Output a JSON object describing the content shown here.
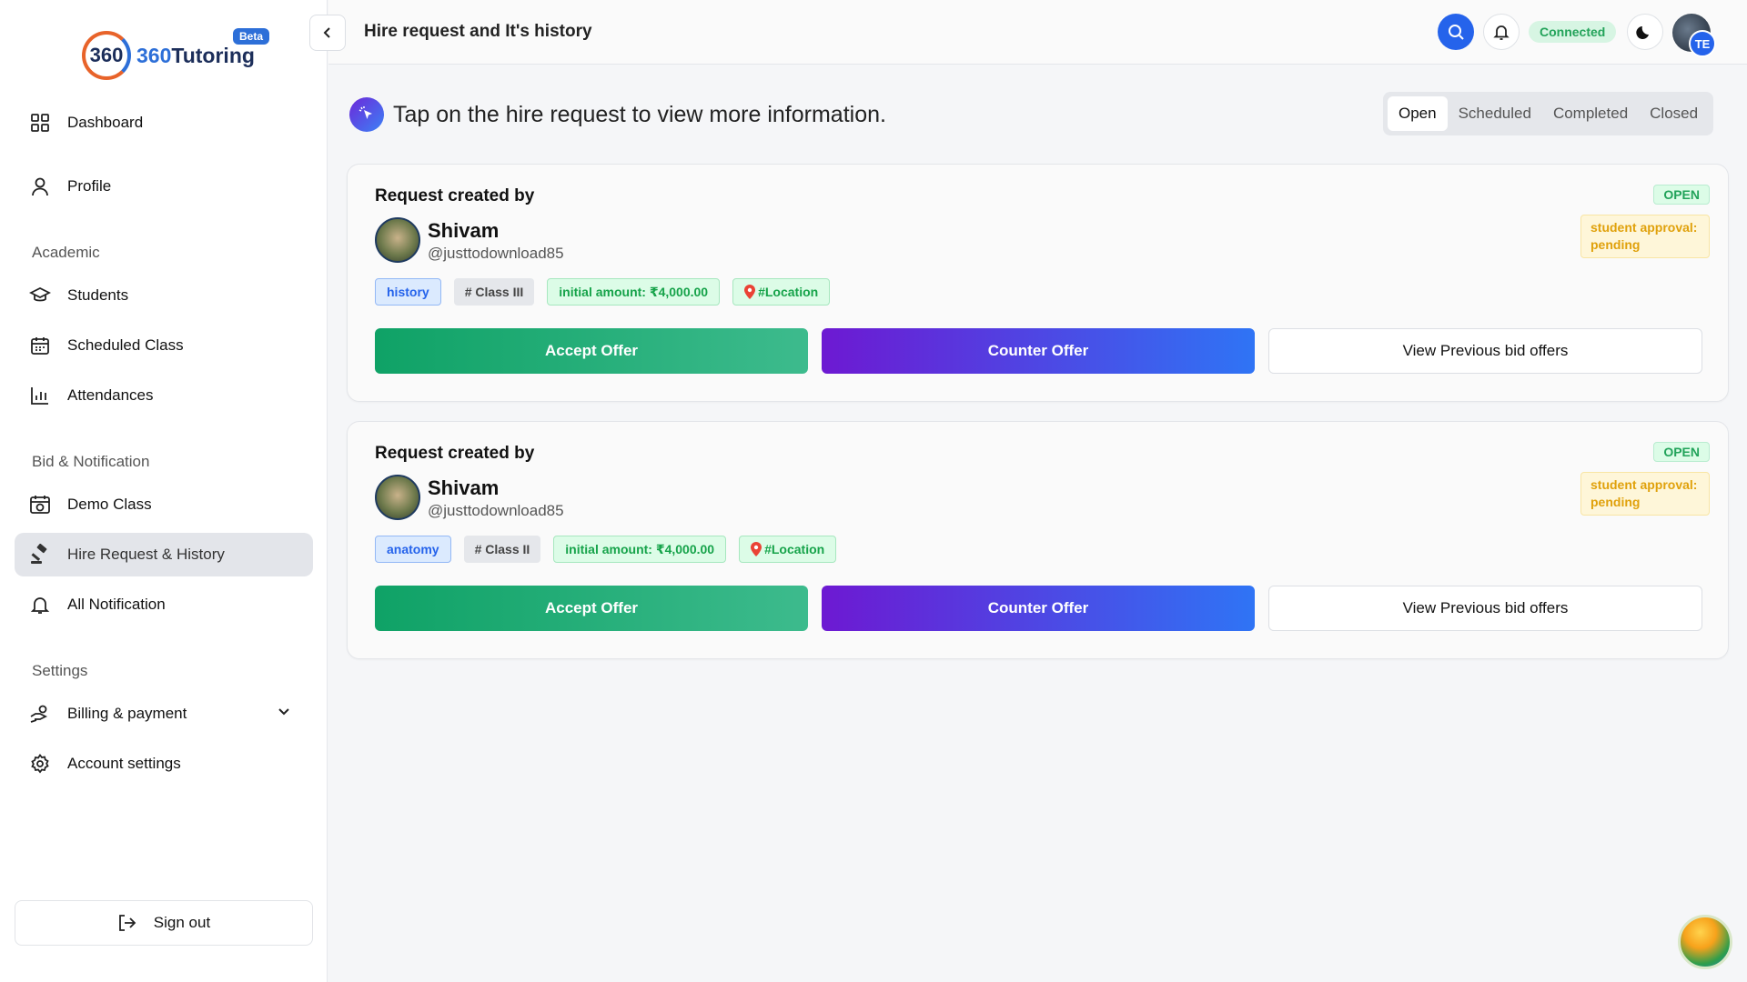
{
  "brand": {
    "logo_mark": "360",
    "name_num": "360",
    "name_text": "Tutoring",
    "badge": "Beta"
  },
  "sidebar": {
    "items_top": [
      {
        "label": "Dashboard",
        "icon": "grid-icon"
      },
      {
        "label": "Profile",
        "icon": "user-icon"
      }
    ],
    "sections": {
      "academic": "Academic",
      "bid": "Bid & Notification",
      "settings": "Settings"
    },
    "academic_items": [
      {
        "label": "Students",
        "icon": "graduation-cap-icon"
      },
      {
        "label": "Scheduled Class",
        "icon": "calendar-icon"
      },
      {
        "label": "Attendances",
        "icon": "bar-chart-icon"
      }
    ],
    "bid_items": [
      {
        "label": "Demo Class",
        "icon": "calendar-play-icon"
      },
      {
        "label": "Hire Request & History",
        "icon": "gavel-icon",
        "active": true
      },
      {
        "label": "All Notification",
        "icon": "bell-icon"
      }
    ],
    "settings_items": [
      {
        "label": "Billing & payment",
        "icon": "hand-coins-icon"
      },
      {
        "label": "Account settings",
        "icon": "gear-icon"
      }
    ],
    "signout": "Sign out"
  },
  "header": {
    "title": "Hire request and It's history",
    "connection_status": "Connected",
    "avatar_initials": "TE"
  },
  "main": {
    "hint": "Tap on the hire request to view more information.",
    "tabs": [
      "Open",
      "Scheduled",
      "Completed",
      "Closed"
    ],
    "active_tab": "Open",
    "requests": [
      {
        "heading": "Request created by",
        "name": "Shivam",
        "username": "@justtodownload85",
        "subject": "history",
        "class": "# Class III",
        "amount": "initial amount: ₹4,000.00",
        "location": "#Location",
        "status": "OPEN",
        "approval": "student approval: pending",
        "accept": "Accept Offer",
        "counter": "Counter Offer",
        "view": "View Previous bid offers"
      },
      {
        "heading": "Request created by",
        "name": "Shivam",
        "username": "@justtodownload85",
        "subject": "anatomy",
        "class": "# Class II",
        "amount": "initial amount: ₹4,000.00",
        "location": "#Location",
        "status": "OPEN",
        "approval": "student approval: pending",
        "accept": "Accept Offer",
        "counter": "Counter Offer",
        "view": "View Previous bid offers"
      }
    ]
  },
  "colors": {
    "primary": "#2563eb",
    "accept_green": "#0fa266",
    "counter_purple": "#6d19d2",
    "status_green": "#22a35a",
    "pending_amber": "#e0a10b"
  }
}
